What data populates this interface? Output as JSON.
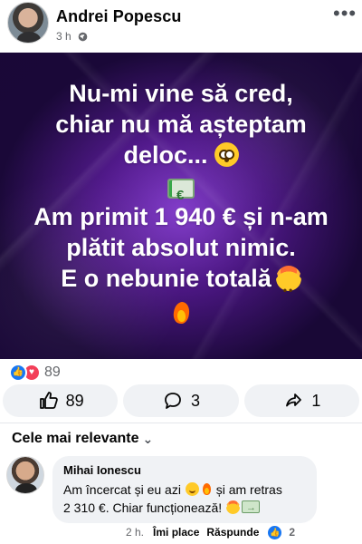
{
  "post": {
    "author": "Andrei Popescu",
    "time": "3 h",
    "privacy_icon": "globe-icon",
    "menu_icon": "more-options-icon",
    "image_text": {
      "line1": "Nu-mi vine să cred,",
      "line2": "chiar nu mă așteptam",
      "line3": "deloc...",
      "line4": "Am primit 1 940 € și n-am",
      "line5": "plătit absolut nimic.",
      "line6": "E o nebunie totală"
    },
    "reaction_count": "89",
    "actions": {
      "like_count": "89",
      "comment_count": "3",
      "share_count": "1"
    }
  },
  "comments_section": {
    "sort_label": "Cele mai relevante",
    "comment": {
      "author": "Mihai Ionescu",
      "line1_start": "Am încercat și eu azi",
      "line1_end": "și am retras",
      "line2": "2 310 €. Chiar funcționează!",
      "time": "2 h.",
      "like_label": "Îmi place",
      "reply_label": "Răspunde",
      "reaction_count": "2"
    }
  },
  "colors": {
    "facebook_blue": "#1877f2",
    "love_red": "#f33e58",
    "comment_bg": "#f0f2f5",
    "purple_background": "#4b168b"
  },
  "icons": [
    "globe-icon",
    "more-options-icon",
    "like-icon",
    "comment-icon",
    "share-icon",
    "chevron-down-icon",
    "flushed-face-icon",
    "money-icon",
    "exploding-head-icon",
    "fire-icon"
  ]
}
